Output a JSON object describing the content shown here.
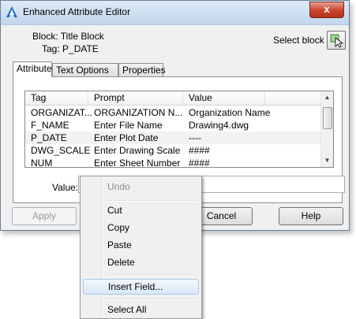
{
  "window": {
    "title": "Enhanced Attribute Editor",
    "close_glyph": "x"
  },
  "header": {
    "block_line": "Block: Title Block",
    "tag_line": "Tag: P_DATE",
    "select_block_label": "Select block"
  },
  "tabs": [
    {
      "label": "Attribute",
      "active": true
    },
    {
      "label": "Text Options",
      "active": false
    },
    {
      "label": "Properties",
      "active": false
    }
  ],
  "table": {
    "columns": [
      "Tag",
      "Prompt",
      "Value"
    ],
    "rows": [
      {
        "tag": "ORGANIZAT...",
        "prompt": "ORGANIZATION N...",
        "value": "Organization Name"
      },
      {
        "tag": "F_NAME",
        "prompt": "Enter File Name",
        "value": "Drawing4.dwg"
      },
      {
        "tag": "P_DATE",
        "prompt": "Enter Plot Date",
        "value": "----"
      },
      {
        "tag": "DWG_SCALE",
        "prompt": "Enter Drawing Scale",
        "value": "####"
      },
      {
        "tag": "NUM",
        "prompt": "Enter Sheet Number",
        "value": "####"
      }
    ]
  },
  "value_field": {
    "label": "Value:",
    "value": ""
  },
  "buttons": {
    "apply": "Apply",
    "cancel": "Cancel",
    "help": "Help"
  },
  "context_menu": {
    "items": [
      {
        "label": "Undo",
        "disabled": true
      },
      {
        "label": "Cut",
        "disabled": false
      },
      {
        "label": "Copy",
        "disabled": false
      },
      {
        "label": "Paste",
        "disabled": false
      },
      {
        "label": "Delete",
        "disabled": false
      },
      {
        "label": "Insert Field...",
        "disabled": false,
        "highlighted": true
      },
      {
        "label": "Select All",
        "disabled": false
      }
    ]
  },
  "icons": {
    "app": "autocad-a-icon",
    "select_block": "select-object-icon"
  }
}
